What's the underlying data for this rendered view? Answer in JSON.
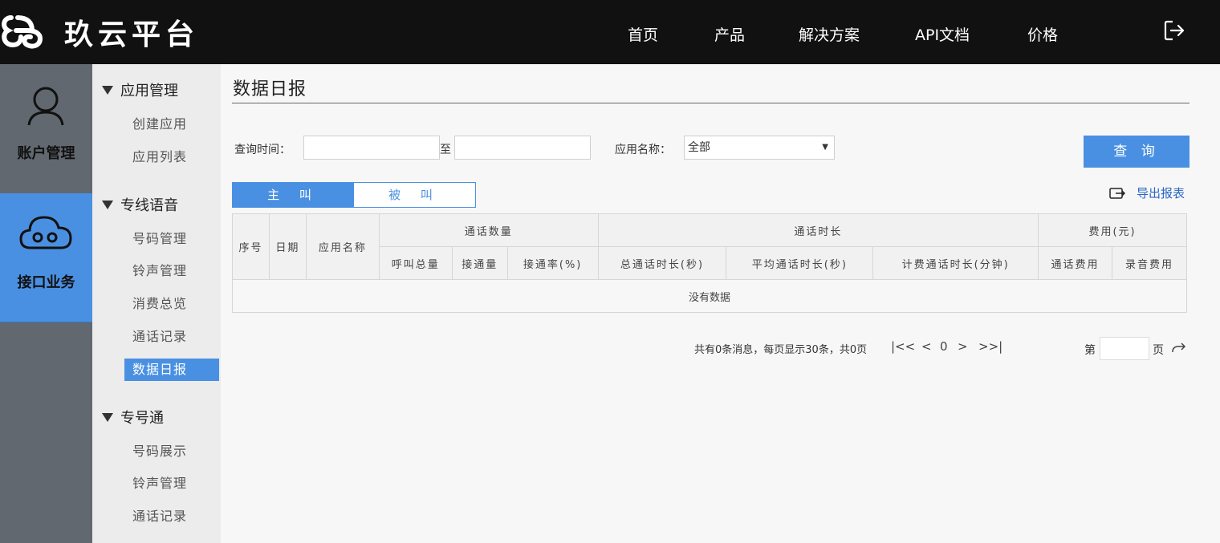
{
  "header": {
    "logo_text": "玖云平台",
    "nav": [
      "首页",
      "产品",
      "解决方案",
      "API文档",
      "价格"
    ]
  },
  "sidebar_main": [
    {
      "label": "账户管理",
      "icon": "user-icon",
      "active": false
    },
    {
      "label": "接口业务",
      "icon": "cloud-icon",
      "active": true
    }
  ],
  "sidebar_sub": {
    "groups": [
      {
        "title": "应用管理",
        "items": [
          "创建应用",
          "应用列表"
        ]
      },
      {
        "title": "专线语音",
        "items": [
          "号码管理",
          "铃声管理",
          "消费总览",
          "通话记录",
          "数据日报"
        ]
      },
      {
        "title": "专号通",
        "items": [
          "号码展示",
          "铃声管理",
          "通话记录"
        ]
      }
    ],
    "active_item": "数据日报"
  },
  "page": {
    "title": "数据日报"
  },
  "filters": {
    "time_label": "查询时间：",
    "to_label": "至",
    "start_value": "",
    "end_value": "",
    "app_label": "应用名称：",
    "app_selected": "全部",
    "query_button": "查 询"
  },
  "tabs": [
    "主  叫",
    "被  叫"
  ],
  "active_tab": 0,
  "export_label": "导出报表",
  "table": {
    "headers_row1": {
      "seq": "序号",
      "date": "日期",
      "app": "应用名称",
      "call_count": "通话数量",
      "call_duration": "通话时长",
      "fee": "费用(元)"
    },
    "headers_row2": [
      "呼叫总量",
      "接通量",
      "接通率(%)",
      "总通话时长(秒)",
      "平均通话时长(秒)",
      "计费通话时长(分钟)",
      "通话费用",
      "录音费用"
    ],
    "empty_text": "没有数据"
  },
  "pagination": {
    "info": "共有0条消息，每页显示30条，共0页",
    "first": "|<<",
    "prev": "<",
    "current": "0",
    "next": ">",
    "last": ">>|",
    "page_prefix": "第",
    "page_suffix": "页"
  },
  "colors": {
    "topbar": "#111111",
    "accent": "#4a90e2",
    "sidebar_dark": "#616870",
    "sidebar_light": "#ececec"
  }
}
